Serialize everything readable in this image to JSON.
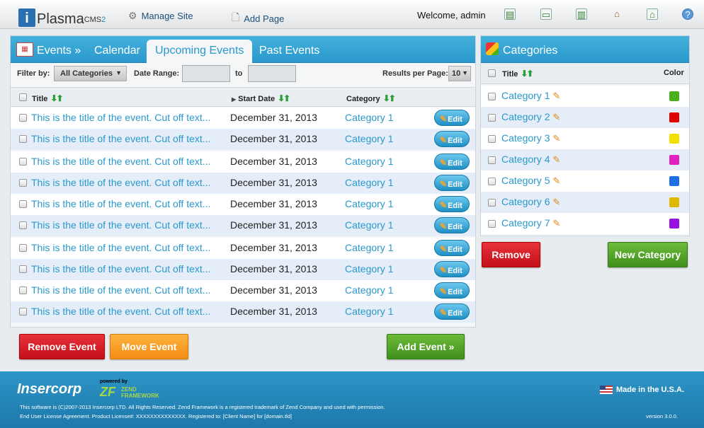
{
  "topbar": {
    "logo_text": "Plasma",
    "logo_sup": "CMS",
    "logo_sup2": "2",
    "manage_site": "Manage Site",
    "add_page": "Add Page",
    "welcome": "Welcome, admin"
  },
  "events": {
    "tabs": {
      "events": "Events »",
      "calendar": "Calendar",
      "upcoming": "Upcoming Events",
      "past": "Past Events"
    },
    "filter": {
      "filter_by": "Filter by:",
      "category_value": "All Categories",
      "date_range": "Date Range:",
      "to": "to",
      "results_label": "Results per Page:",
      "results_value": "10"
    },
    "columns": {
      "title": "Title",
      "start_date": "Start Date",
      "category": "Category"
    },
    "edit_label": "Edit",
    "rows": [
      {
        "title": "This is the title of the event.  Cut off text...",
        "date": "December 31, 2013",
        "category": "Category 1"
      },
      {
        "title": "This is the title of the event.  Cut off text...",
        "date": "December 31, 2013",
        "category": "Category 1"
      },
      {
        "title": "This is the title of the event.  Cut off text...",
        "date": "December 31, 2013",
        "category": "Category 1"
      },
      {
        "title": "This is the title of the event.  Cut off text...",
        "date": "December 31, 2013",
        "category": "Category 1"
      },
      {
        "title": "This is the title of the event.  Cut off text...",
        "date": "December 31, 2013",
        "category": "Category 1"
      },
      {
        "title": "This is the title of the event.  Cut off text...",
        "date": "December 31, 2013",
        "category": "Category 1"
      },
      {
        "title": "This is the title of the event.  Cut off text...",
        "date": "December 31, 2013",
        "category": "Category 1"
      },
      {
        "title": "This is the title of the event.  Cut off text...",
        "date": "December 31, 2013",
        "category": "Category 1"
      },
      {
        "title": "This is the title of the event.  Cut off text...",
        "date": "December 31, 2013",
        "category": "Category 1"
      },
      {
        "title": "This is the title of the event.  Cut off text...",
        "date": "December 31, 2013",
        "category": "Category 1"
      }
    ],
    "buttons": {
      "remove": "Remove Event",
      "move": "Move Event",
      "add": "Add Event »"
    }
  },
  "categories": {
    "heading": "Categories",
    "columns": {
      "title": "Title",
      "color": "Color"
    },
    "items": [
      {
        "name": "Category 1",
        "color": "#4caf1c"
      },
      {
        "name": "Category 2",
        "color": "#e00000"
      },
      {
        "name": "Category 3",
        "color": "#f4e000"
      },
      {
        "name": "Category 4",
        "color": "#e020c0"
      },
      {
        "name": "Category 5",
        "color": "#1e6fe0"
      },
      {
        "name": "Category 6",
        "color": "#e0b800"
      },
      {
        "name": "Category 7",
        "color": "#9a10e0"
      }
    ],
    "buttons": {
      "remove": "Remove",
      "new": "New Category"
    }
  },
  "footer": {
    "brand": "Insercorp",
    "powered_by": "powered by",
    "zf_mark": "ZF",
    "zf_name": "ZEND FRAMEWORK",
    "made_in": "Made in the U.S.A.",
    "copyright": "This software is (C)2007-2013 Insercorp LTD. All Rights Reserved.  Zend Framework is a registered trademark of Zend Company and used with permission.",
    "license": "End User License Agreement.  Product License#: XXXXXXXXXXXXXX.  Registered to: [Client Name] for [domain.tld]",
    "version": "version 3.0.0."
  }
}
